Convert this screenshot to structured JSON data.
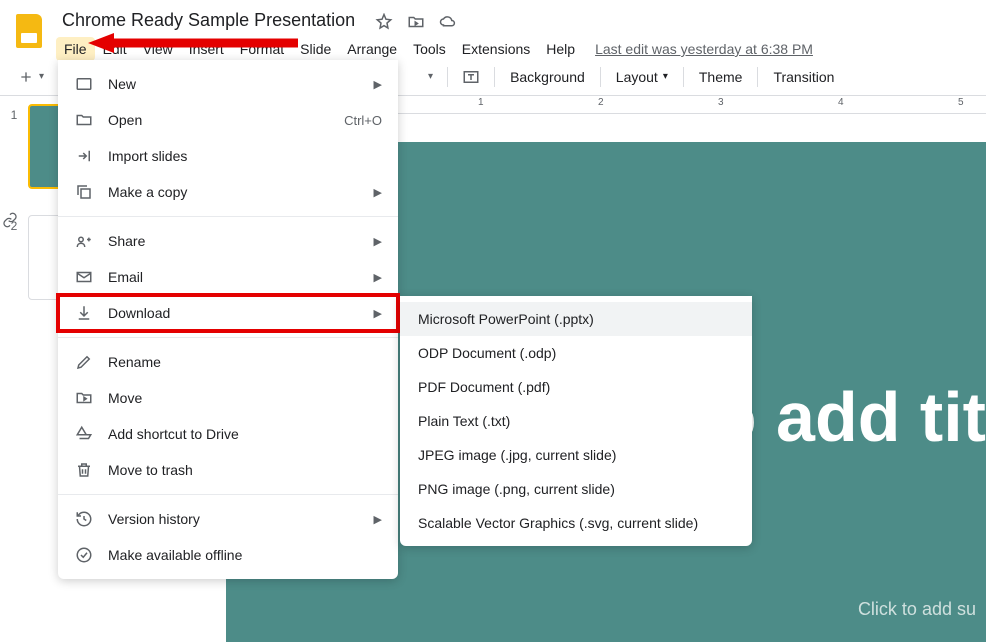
{
  "header": {
    "doc_title": "Chrome Ready Sample Presentation"
  },
  "menubar": {
    "items": [
      "File",
      "Edit",
      "View",
      "Insert",
      "Format",
      "Slide",
      "Arrange",
      "Tools",
      "Extensions",
      "Help"
    ],
    "last_edit": "Last edit was yesterday at 6:38 PM"
  },
  "toolbar": {
    "background": "Background",
    "layout": "Layout",
    "theme": "Theme",
    "transition": "Transition"
  },
  "ruler": {
    "marks": [
      "1",
      "1",
      "2",
      "3",
      "4",
      "5"
    ]
  },
  "slides": {
    "thumb1_num": "1",
    "thumb2_num": "2"
  },
  "canvas": {
    "title_text": "o add tit",
    "subtitle_text": "Click to add su"
  },
  "file_menu": {
    "new": "New",
    "open": "Open",
    "open_shortcut": "Ctrl+O",
    "import": "Import slides",
    "copy": "Make a copy",
    "share": "Share",
    "email": "Email",
    "download": "Download",
    "rename": "Rename",
    "move": "Move",
    "shortcut": "Add shortcut to Drive",
    "trash": "Move to trash",
    "history": "Version history",
    "offline": "Make available offline"
  },
  "download_submenu": {
    "items": [
      "Microsoft PowerPoint (.pptx)",
      "ODP Document (.odp)",
      "PDF Document (.pdf)",
      "Plain Text (.txt)",
      "JPEG image (.jpg, current slide)",
      "PNG image (.png, current slide)",
      "Scalable Vector Graphics (.svg, current slide)"
    ]
  }
}
